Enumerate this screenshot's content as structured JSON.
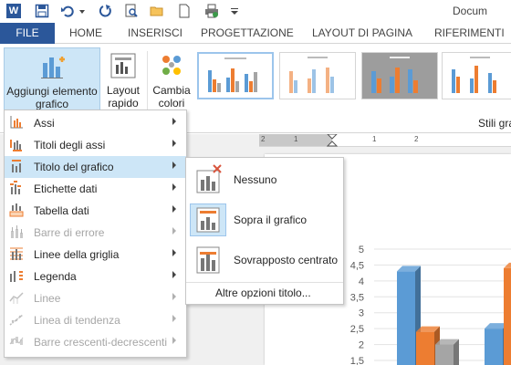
{
  "window": {
    "doc_title": "Docum",
    "qat_icons": [
      "word-icon",
      "save-icon",
      "undo-icon",
      "undo-dropdown-icon",
      "redo-icon",
      "print-preview-icon",
      "open-icon",
      "new-icon",
      "print-icon",
      "customize-icon"
    ]
  },
  "tabs": [
    {
      "label": "FILE"
    },
    {
      "label": "HOME"
    },
    {
      "label": "INSERISCI"
    },
    {
      "label": "PROGETTAZIONE"
    },
    {
      "label": "LAYOUT DI PAGINA"
    },
    {
      "label": "RIFERIMENTI"
    }
  ],
  "ribbon": {
    "add_element": {
      "line1": "Aggiungi elemento",
      "line2": "grafico"
    },
    "quick_layout": {
      "line1": "Layout",
      "line2": "rapido"
    },
    "change_colors": {
      "line1": "Cambia",
      "line2": "colori"
    },
    "styles_group_label": "Stili gra"
  },
  "menu": {
    "items": [
      {
        "label": "Assi",
        "icon": "axes-icon",
        "enabled": true
      },
      {
        "label": "Titoli degli assi",
        "icon": "axis-titles-icon",
        "enabled": true
      },
      {
        "label": "Titolo del grafico",
        "icon": "chart-title-icon",
        "enabled": true,
        "active": true
      },
      {
        "label": "Etichette dati",
        "icon": "data-labels-icon",
        "enabled": true
      },
      {
        "label": "Tabella dati",
        "icon": "data-table-icon",
        "enabled": true
      },
      {
        "label": "Barre di errore",
        "icon": "error-bars-icon",
        "enabled": false
      },
      {
        "label": "Linee della griglia",
        "icon": "gridlines-icon",
        "enabled": true
      },
      {
        "label": "Legenda",
        "icon": "legend-icon",
        "enabled": true
      },
      {
        "label": "Linee",
        "icon": "lines-icon",
        "enabled": false
      },
      {
        "label": "Linea di tendenza",
        "icon": "trendline-icon",
        "enabled": false
      },
      {
        "label": "Barre crescenti-decrescenti",
        "icon": "up-down-bars-icon",
        "enabled": false
      }
    ]
  },
  "submenu": {
    "items": [
      {
        "label": "Nessuno",
        "icon": "no-title-icon"
      },
      {
        "label": "Sopra il grafico",
        "icon": "above-chart-icon",
        "active": true
      },
      {
        "label": "Sovrapposto centrato",
        "icon": "centered-overlay-icon"
      }
    ],
    "more": "Altre opzioni titolo..."
  },
  "ruler": {
    "labels": [
      "2",
      "1",
      "1",
      "2"
    ]
  },
  "chart_data": {
    "type": "bar",
    "y_tick_labels": [
      "5",
      "4,5",
      "4",
      "3,5",
      "3",
      "2,5",
      "2",
      "1,5"
    ],
    "ylim": [
      1.5,
      5
    ],
    "series": [
      {
        "color": "#5b9bd5",
        "values": [
          4.3,
          2.5
        ]
      },
      {
        "color": "#ed7d31",
        "values": [
          2.4,
          4.4
        ]
      },
      {
        "color": "#a5a5a5",
        "values": [
          2.0
        ]
      }
    ]
  },
  "colors": {
    "accent": "#2b579a",
    "highlight": "#cde6f7"
  }
}
